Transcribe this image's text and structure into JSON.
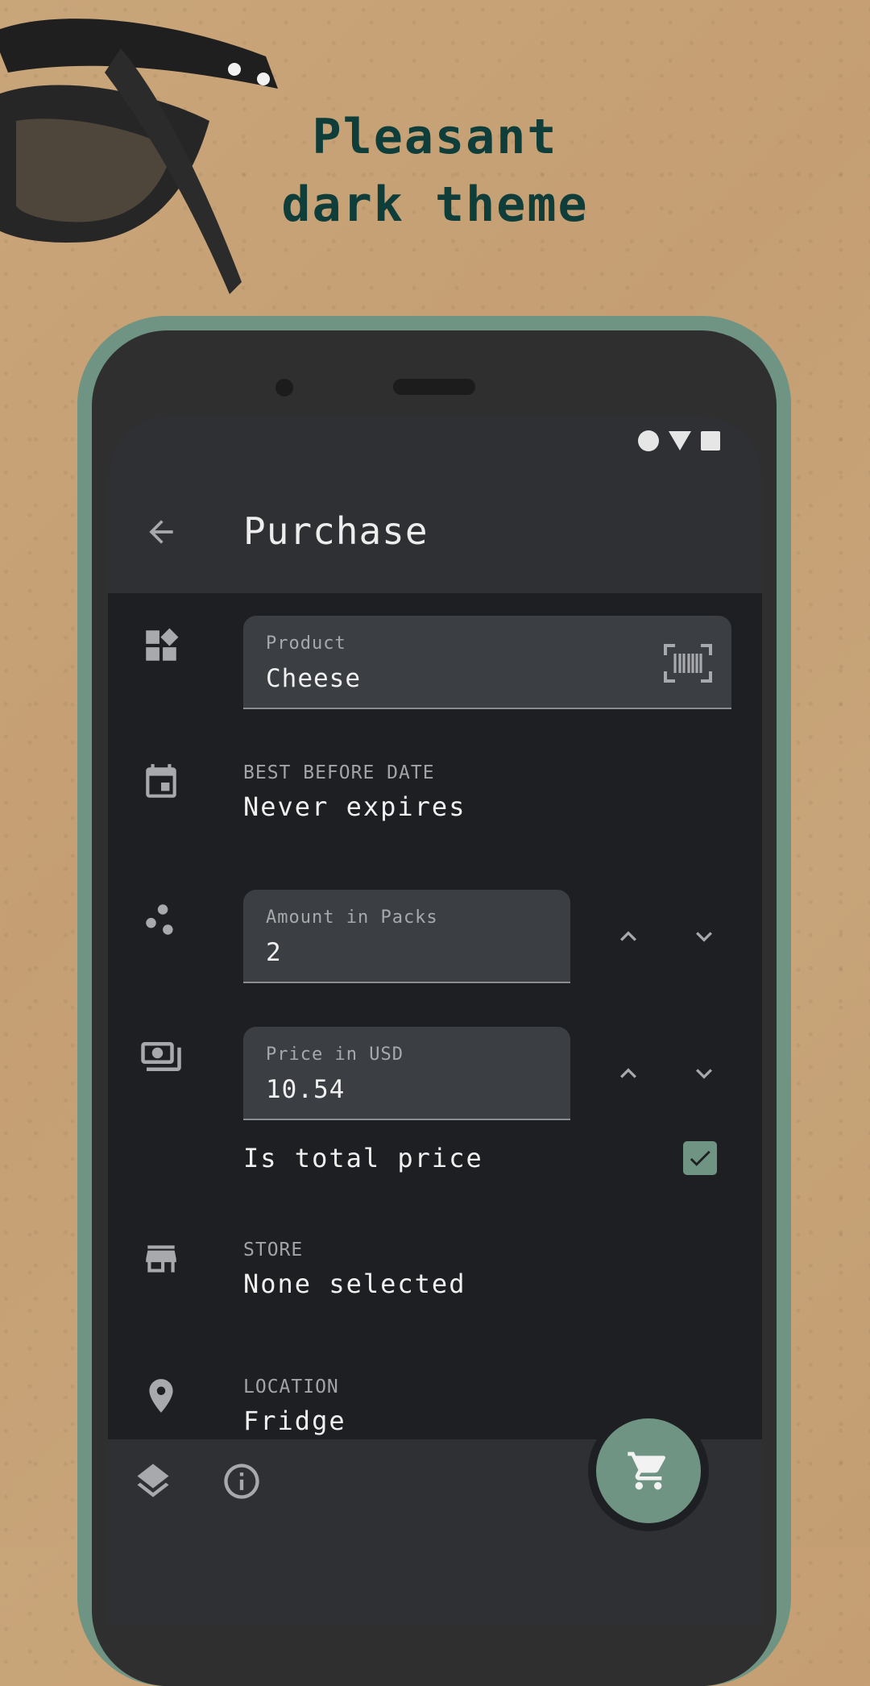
{
  "promo": {
    "headline_line1": "Pleasant",
    "headline_line2": "dark theme"
  },
  "appbar": {
    "title": "Purchase",
    "back_icon": "arrow-back-icon"
  },
  "form": {
    "product": {
      "label": "Product",
      "value": "Cheese",
      "icon": "category-icon",
      "scan_icon": "barcode-scan-icon"
    },
    "best_before": {
      "label": "BEST BEFORE DATE",
      "value": "Never expires",
      "icon": "calendar-icon"
    },
    "amount": {
      "label": "Amount in Packs",
      "value": "2",
      "icon": "scatter-dots-icon"
    },
    "price": {
      "label": "Price in USD",
      "value": "10.54",
      "icon": "cash-icon"
    },
    "total_price": {
      "label": "Is total price",
      "checked": true
    },
    "store": {
      "label": "STORE",
      "value": "None selected",
      "icon": "store-icon"
    },
    "location": {
      "label": "LOCATION",
      "value": "Fridge",
      "icon": "location-pin-icon"
    }
  },
  "bottom_bar": {
    "icons": [
      "layers-icon",
      "info-icon"
    ],
    "fab_icon": "cart-icon"
  },
  "colors": {
    "accent": "#6f9484",
    "headline": "#0f3d3a",
    "surface": "#1e1f22",
    "bar": "#2e3033",
    "field": "#3b3e42"
  }
}
